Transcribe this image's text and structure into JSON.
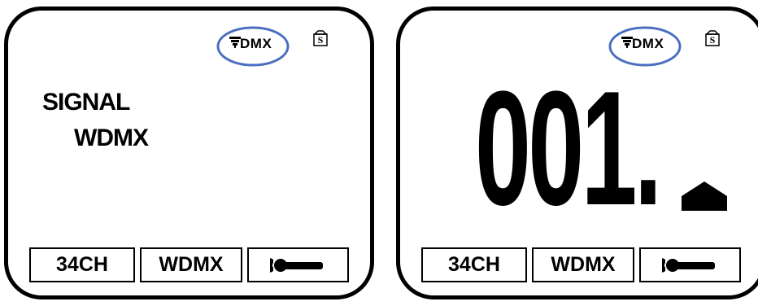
{
  "left_panel": {
    "status": {
      "dmx_label": "DMX",
      "storage_label": "S"
    },
    "signal_lines": [
      "SIGNAL",
      "WDMX"
    ],
    "bottom_bar": {
      "channel_label": "34CH",
      "mode_label": "WDMX",
      "tool_icon": "wrench-icon"
    }
  },
  "right_panel": {
    "status": {
      "dmx_label": "DMX",
      "storage_label": "S"
    },
    "address_value": "001.",
    "bottom_bar": {
      "channel_label": "34CH",
      "mode_label": "WDMX",
      "tool_icon": "wrench-icon"
    }
  },
  "colors": {
    "highlight_circle": "#4a6fc0",
    "foreground": "#000000",
    "background": "#ffffff"
  }
}
